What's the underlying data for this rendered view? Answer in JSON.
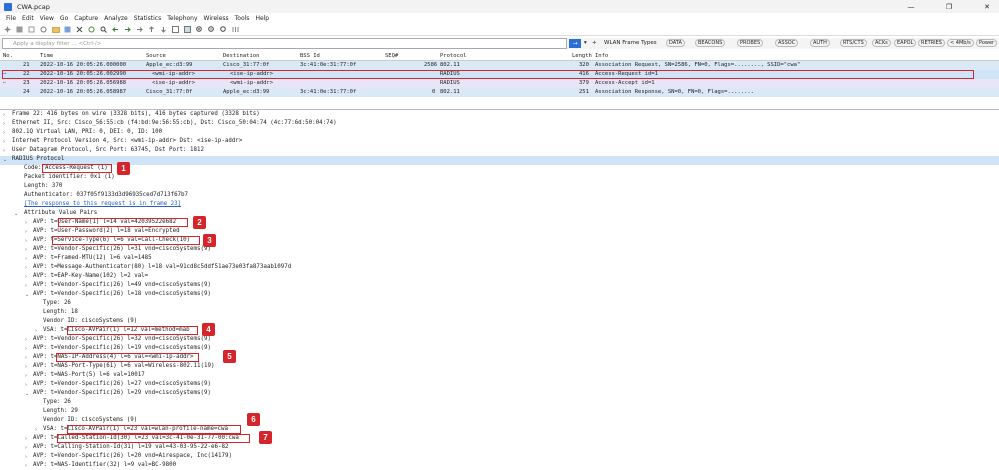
{
  "window": {
    "title": "CWA.pcap",
    "minimize": "—",
    "maximize": "❐",
    "close": "✕"
  },
  "menu": [
    "File",
    "Edit",
    "View",
    "Go",
    "Capture",
    "Analyze",
    "Statistics",
    "Telephony",
    "Wireless",
    "Tools",
    "Help"
  ],
  "filter": {
    "placeholder": "Apply a display filter … <Ctrl-/>",
    "apply_icon": "arrow-right-icon",
    "dropdown": "▾",
    "add": "+"
  },
  "wlan_toolbar": [
    "WLAN Frame Types",
    "DATA",
    "BEACONS",
    "PROBES",
    "ASSOC",
    "AUTH",
    "RTS/CTS",
    "ACKs",
    "EAPOL",
    "RETRIES",
    "< 4Mb/s",
    "Power"
  ],
  "columns": [
    "No.",
    "Time",
    "Source",
    "Destination",
    "BSS Id",
    "SEQ#",
    "Protocol",
    "Length",
    "Info"
  ],
  "packets": [
    {
      "no": "21",
      "time": "2022-10-16 20:05:26.000000",
      "src": "Apple_ec:d3:99",
      "dst": "Cisco_31:77:0f",
      "bss": "3c:41:0e:31:77:0f",
      "seq": "2586",
      "proto": "802.11",
      "len": "320",
      "info": "Association Request, SN=2586, FN=0, Flags=........, SSID=\"cwa\""
    },
    {
      "no": "22",
      "time": "2022-10-16 20:05:26.002990",
      "src": "<wmi-ip-addr>",
      "dst": "<ise-ip-addr>",
      "bss": "",
      "seq": "",
      "proto": "RADIUS",
      "len": "416",
      "info": "Access-Request id=1"
    },
    {
      "no": "23",
      "time": "2022-10-16 20:05:26.056988",
      "src": "<ise-ip-addr>",
      "dst": "<wmi-ip-addr>",
      "bss": "",
      "seq": "",
      "proto": "RADIUS",
      "len": "379",
      "info": "Access-Accept id=1"
    },
    {
      "no": "24",
      "time": "2022-10-16 20:05:26.058987",
      "src": "Cisco_31:77:0f",
      "dst": "Apple_ec:d3:99",
      "bss": "3c:41:0e:31:77:0f",
      "seq": "0",
      "proto": "802.11",
      "len": "251",
      "info": "Association Response, SN=0, FN=0, Flags=........"
    }
  ],
  "details": [
    "Frame 22: 416 bytes on wire (3328 bits), 416 bytes captured (3328 bits)",
    "Ethernet II, Src: Cisco_56:55:cb (f4:bd:9e:56:55:cb), Dst: Cisco_50:04:74 (4c:77:6d:50:04:74)",
    "802.1Q Virtual LAN, PRI: 0, DEI: 0, ID: 100",
    "Internet Protocol Version 4, Src: <wmi-ip-addr>   Dst: <ise-ip-addr>",
    "User Datagram Protocol, Src Port: 63745, Dst Port: 1812",
    "RADIUS Protocol",
    "Code: Access-Request (1)",
    "Packet identifier: 0x1 (1)",
    "Length: 370",
    "Authenticator: 037f05f9133d3d96935ced7d713f67b7",
    "[The response to this request is in frame 23]",
    "Attribute Value Pairs",
    "AVP: t=User-Name(1) l=14 val=42039522e682",
    "AVP: t=User-Password(2) l=18 val=Encrypted",
    "AVP: t=Service-Type(6) l=6 val=Call-Check(10)",
    "AVP: t=Vendor-Specific(26) l=31 vnd=ciscoSystems(9)",
    "AVP: t=Framed-MTU(12) l=6 val=1485",
    "AVP: t=Message-Authenticator(80) l=18 val=91cd8c5ddf51ae73e03fa873aab1097d",
    "AVP: t=EAP-Key-Name(102) l=2 val=",
    "AVP: t=Vendor-Specific(26) l=49 vnd=ciscoSystems(9)",
    "AVP: t=Vendor-Specific(26) l=18 vnd=ciscoSystems(9)",
    "Type: 26",
    "Length: 18",
    "Vendor ID: ciscoSystems (9)",
    "VSA: t=Cisco-AVPair(1) l=12 val=method=mab",
    "AVP: t=Vendor-Specific(26) l=32 vnd=ciscoSystems(9)",
    "AVP: t=Vendor-Specific(26) l=19 vnd=ciscoSystems(9)",
    "AVP: t=NAS-IP-Address(4) l=6 val=<wmi-ip-addr>",
    "AVP: t=NAS-Port-Type(61) l=6 val=Wireless-802.11(19)",
    "AVP: t=NAS-Port(5) l=6 val=10017",
    "AVP: t=Vendor-Specific(26) l=27 vnd=ciscoSystems(9)",
    "AVP: t=Vendor-Specific(26) l=29 vnd=ciscoSystems(9)",
    "Type: 26",
    "Length: 29",
    "Vendor ID: ciscoSystems (9)",
    "VSA: t=Cisco-AVPair(1) l=23 val=wlan-profile-name=cwa",
    "AVP: t=Called-Station-Id(30) l=23 val=3c-41-0e-31-77-00:cwa",
    "AVP: t=Calling-Station-Id(31) l=19 val=43-03-95-22-e6-82",
    "AVP: t=Vendor-Specific(26) l=20 vnd=Airespace, Inc(14179)",
    "AVP: t=NAS-Identifier(32) l=9 val=BC-9800"
  ],
  "badges": [
    "1",
    "2",
    "3",
    "4",
    "5",
    "6",
    "7"
  ],
  "colors": {
    "selected_row": "#cfe4f7",
    "highlight": "#d6242b",
    "radius_row": "#e9e5f8",
    "wlan_row": "#dbe9f7"
  }
}
